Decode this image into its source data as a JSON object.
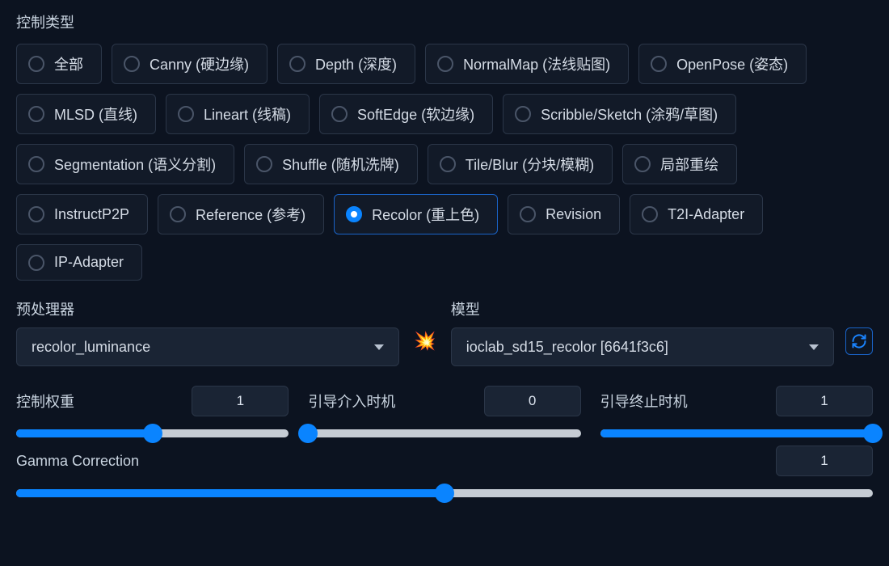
{
  "control_type_label": "控制类型",
  "control_types": [
    {
      "label": "全部",
      "selected": false
    },
    {
      "label": "Canny (硬边缘)",
      "selected": false
    },
    {
      "label": "Depth (深度)",
      "selected": false
    },
    {
      "label": "NormalMap (法线贴图)",
      "selected": false
    },
    {
      "label": "OpenPose (姿态)",
      "selected": false
    },
    {
      "label": "MLSD (直线)",
      "selected": false
    },
    {
      "label": "Lineart (线稿)",
      "selected": false
    },
    {
      "label": "SoftEdge (软边缘)",
      "selected": false
    },
    {
      "label": "Scribble/Sketch (涂鸦/草图)",
      "selected": false
    },
    {
      "label": "Segmentation (语义分割)",
      "selected": false
    },
    {
      "label": "Shuffle (随机洗牌)",
      "selected": false
    },
    {
      "label": "Tile/Blur (分块/模糊)",
      "selected": false
    },
    {
      "label": "局部重绘",
      "selected": false
    },
    {
      "label": "InstructP2P",
      "selected": false
    },
    {
      "label": "Reference (参考)",
      "selected": false
    },
    {
      "label": "Recolor (重上色)",
      "selected": true
    },
    {
      "label": "Revision",
      "selected": false
    },
    {
      "label": "T2I-Adapter",
      "selected": false
    },
    {
      "label": "IP-Adapter",
      "selected": false
    }
  ],
  "preprocessor": {
    "label": "预处理器",
    "value": "recolor_luminance"
  },
  "model": {
    "label": "模型",
    "value": "ioclab_sd15_recolor [6641f3c6]"
  },
  "sliders": {
    "weight": {
      "label": "控制权重",
      "value": "1",
      "percent": 50
    },
    "start": {
      "label": "引导介入时机",
      "value": "0",
      "percent": 0
    },
    "end": {
      "label": "引导终止时机",
      "value": "1",
      "percent": 100
    },
    "gamma": {
      "label": "Gamma Correction",
      "value": "1",
      "percent": 50
    }
  }
}
